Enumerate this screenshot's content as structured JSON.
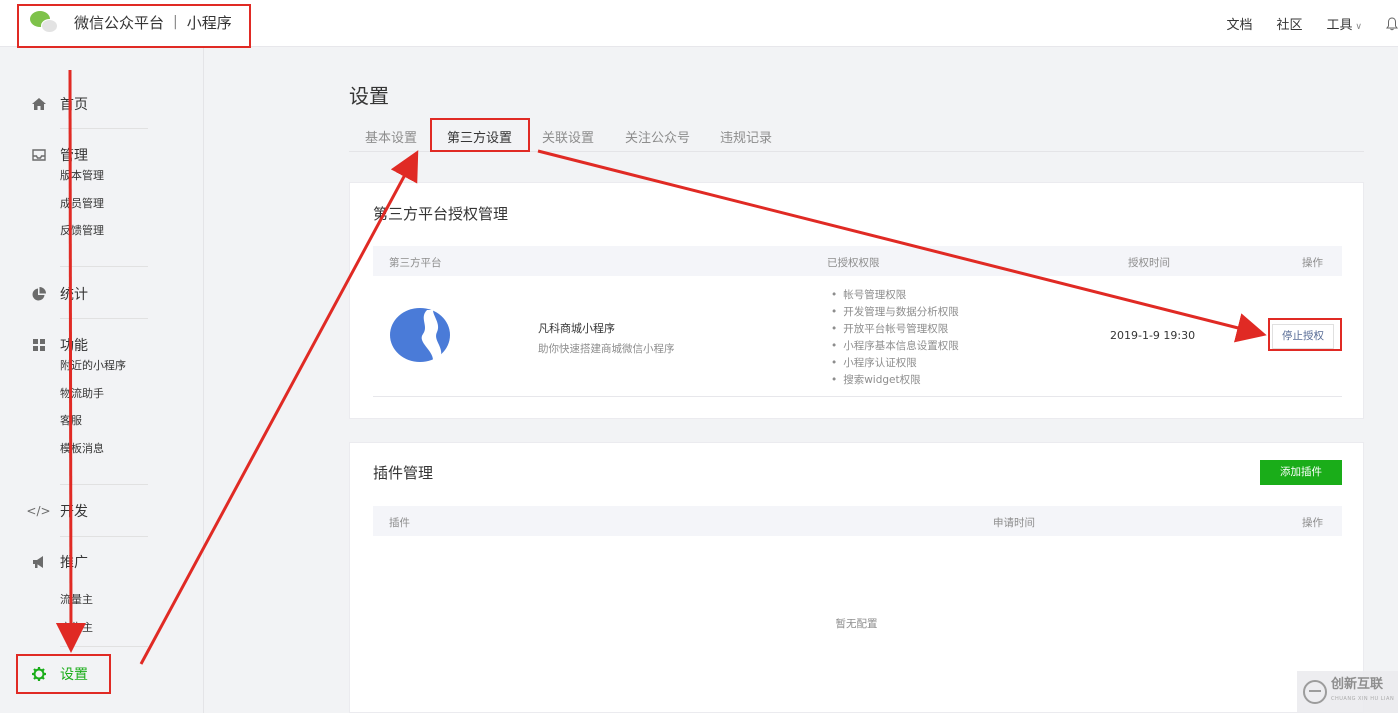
{
  "header": {
    "brand": "微信公众平台",
    "separator": "|",
    "product": "小程序",
    "links": [
      "文档",
      "社区",
      "工具"
    ]
  },
  "sidebar": {
    "home": "首页",
    "manage": {
      "label": "管理",
      "items": [
        "版本管理",
        "成员管理",
        "反馈管理"
      ]
    },
    "stats": "统计",
    "features": {
      "label": "功能",
      "items": [
        "附近的小程序",
        "物流助手",
        "客服",
        "模板消息"
      ]
    },
    "dev": "开发",
    "promote": {
      "label": "推广",
      "items": [
        "流量主",
        "广告主"
      ]
    },
    "settings": "设置"
  },
  "main": {
    "title": "设置",
    "tabs": [
      "基本设置",
      "第三方设置",
      "关联设置",
      "关注公众号",
      "违规记录"
    ],
    "active_tab": 1,
    "third_party": {
      "title": "第三方平台授权管理",
      "columns": [
        "第三方平台",
        "已授权权限",
        "授权时间",
        "操作"
      ],
      "row": {
        "name": "凡科商城小程序",
        "desc": "助你快速搭建商城微信小程序",
        "permissions": [
          "帐号管理权限",
          "开发管理与数据分析权限",
          "开放平台帐号管理权限",
          "小程序基本信息设置权限",
          "小程序认证权限",
          "搜索widget权限"
        ],
        "time": "2019-1-9 19:30",
        "action": "停止授权"
      }
    },
    "plugins": {
      "title": "插件管理",
      "add_button": "添加插件",
      "columns": [
        "插件",
        "申请时间",
        "操作"
      ],
      "empty": "暂无配置"
    }
  },
  "watermark": {
    "text": "创新互联",
    "sub": "CHUANG XIN HU LIAN"
  },
  "colors": {
    "accent": "#1aad19",
    "annotation": "#e02a24",
    "link": "#576b95"
  }
}
